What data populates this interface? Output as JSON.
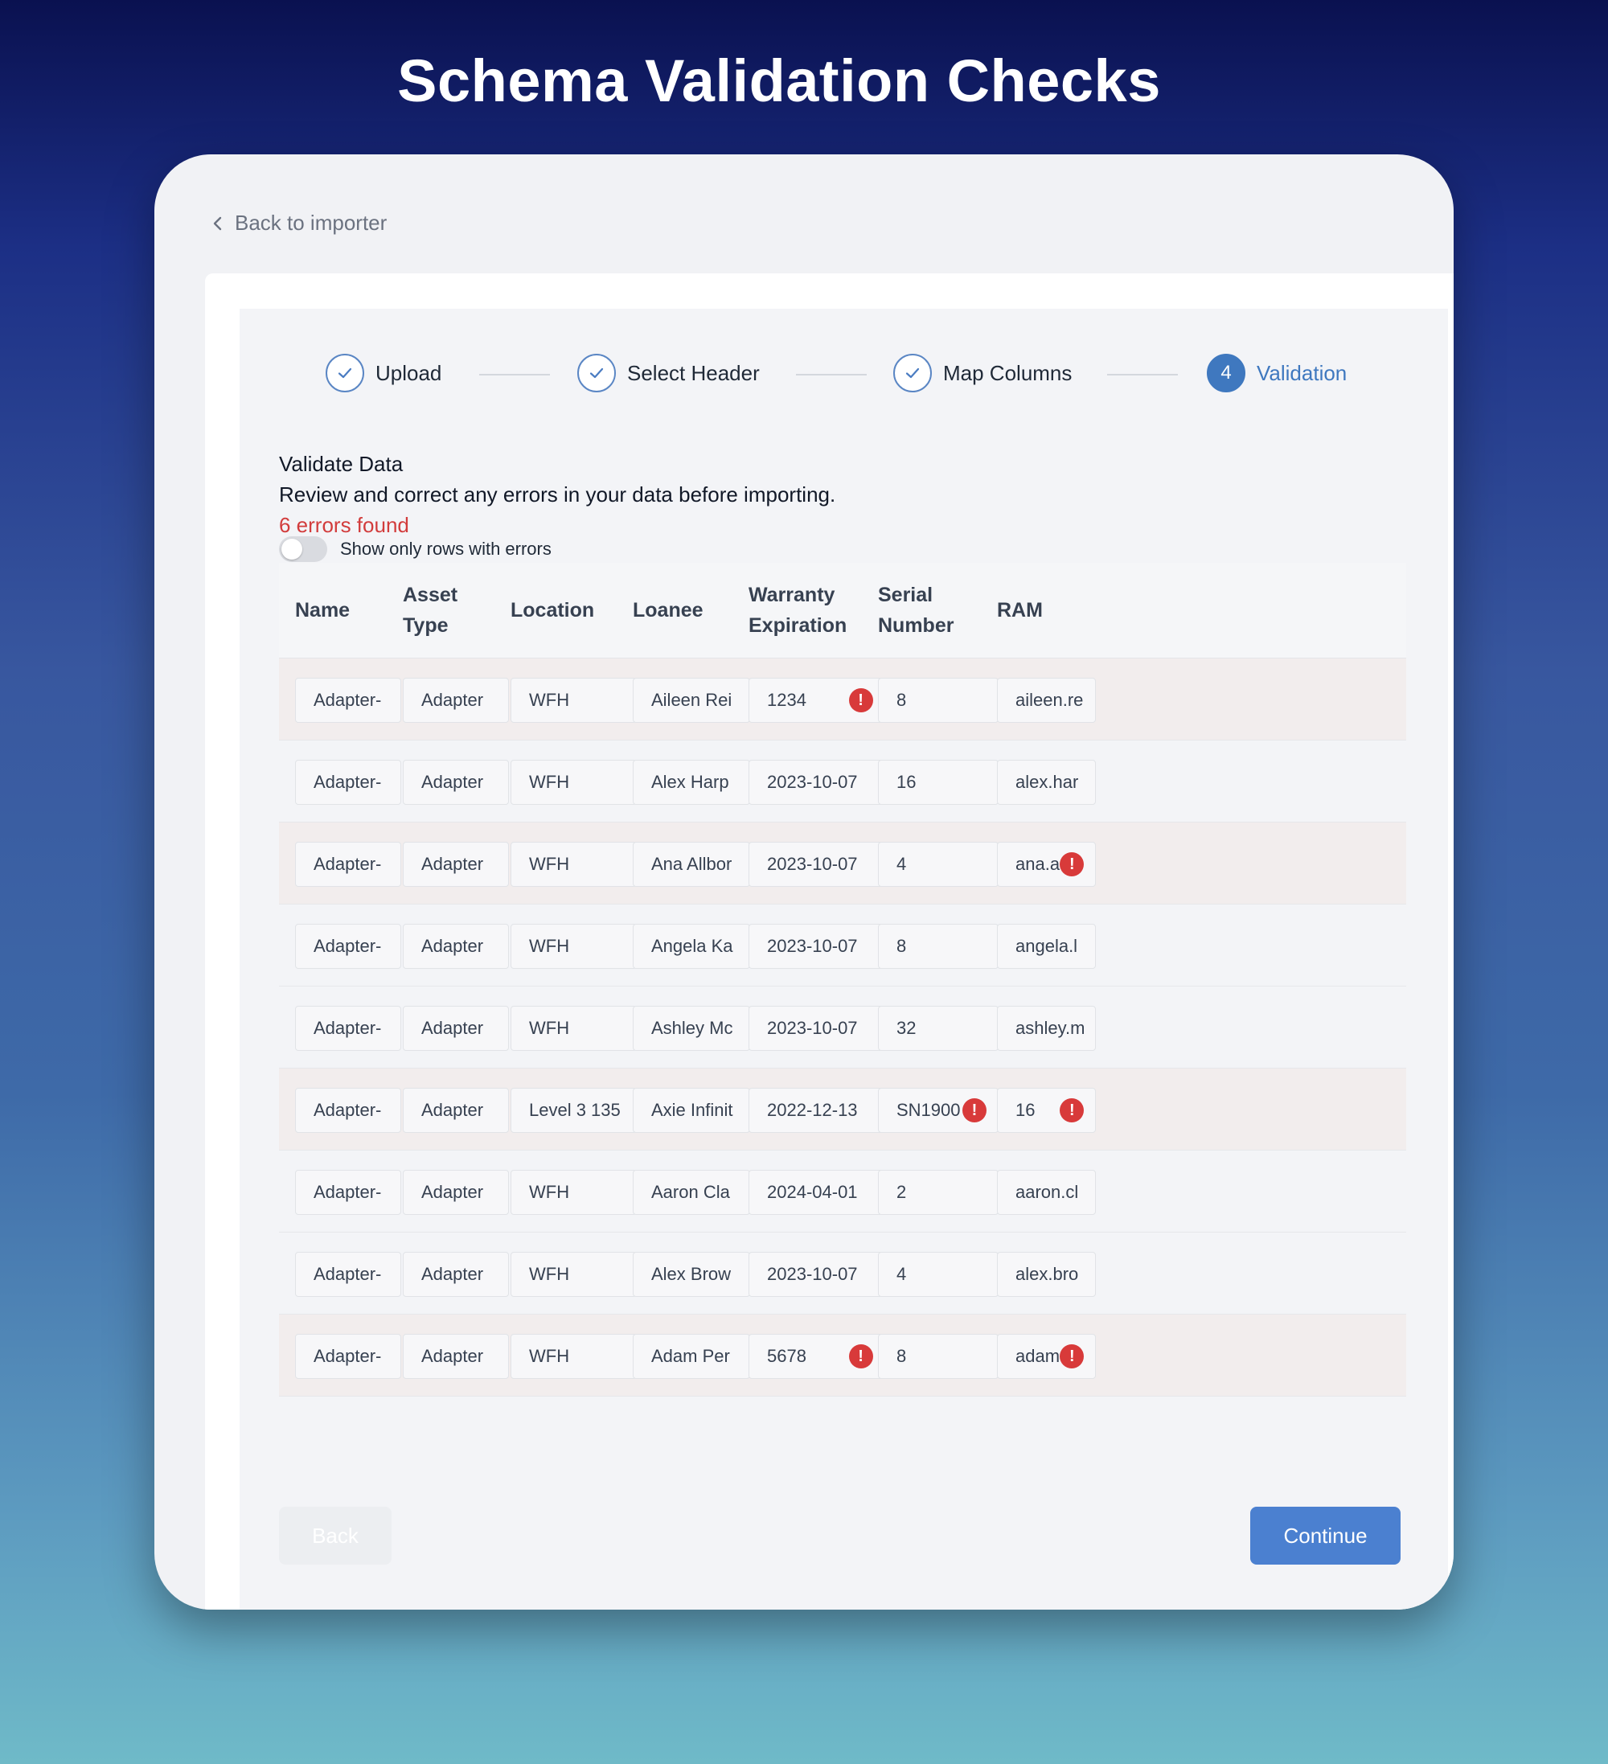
{
  "page_title": "Schema Validation Checks",
  "back_link": "Back to importer",
  "steps": [
    {
      "label": "Upload",
      "status": "done"
    },
    {
      "label": "Select Header",
      "status": "done"
    },
    {
      "label": "Map Columns",
      "status": "done"
    },
    {
      "label": "Validation",
      "number": "4",
      "status": "active"
    }
  ],
  "validate": {
    "title": "Validate Data",
    "description": "Review and correct any errors in your data before importing.",
    "error_count": "6 errors found",
    "toggle_label": "Show only rows with errors",
    "toggle_on": false
  },
  "table": {
    "columns": [
      "Name",
      "Asset Type",
      "Location",
      "Loanee",
      "Warranty Expiration",
      "Serial Number",
      "RAM"
    ],
    "rows": [
      {
        "has_error": true,
        "cells": [
          "Adapter-",
          "Adapter",
          "WFH",
          "Aileen Rei",
          "1234",
          "8",
          "aileen.re"
        ],
        "errors": [
          4
        ]
      },
      {
        "has_error": false,
        "cells": [
          "Adapter-",
          "Adapter",
          "WFH",
          "Alex Harp",
          "2023-10-07",
          "16",
          "alex.har"
        ],
        "errors": []
      },
      {
        "has_error": true,
        "cells": [
          "Adapter-",
          "Adapter",
          "WFH",
          "Ana Allbor",
          "2023-10-07",
          "4",
          "ana.a"
        ],
        "errors": [
          6
        ]
      },
      {
        "has_error": false,
        "cells": [
          "Adapter-",
          "Adapter",
          "WFH",
          "Angela Ka",
          "2023-10-07",
          "8",
          "angela.l"
        ],
        "errors": []
      },
      {
        "has_error": false,
        "cells": [
          "Adapter-",
          "Adapter",
          "WFH",
          "Ashley Mc",
          "2023-10-07",
          "32",
          "ashley.m"
        ],
        "errors": []
      },
      {
        "has_error": true,
        "cells": [
          "Adapter-",
          "Adapter",
          "Level 3 135",
          "Axie Infinit",
          "2022-12-13",
          "SN1900",
          "16"
        ],
        "errors": [
          5,
          6
        ]
      },
      {
        "has_error": false,
        "cells": [
          "Adapter-",
          "Adapter",
          "WFH",
          "Aaron Cla",
          "2024-04-01",
          "2",
          "aaron.cl"
        ],
        "errors": []
      },
      {
        "has_error": false,
        "cells": [
          "Adapter-",
          "Adapter",
          "WFH",
          "Alex Brow",
          "2023-10-07",
          "4",
          "alex.bro"
        ],
        "errors": []
      },
      {
        "has_error": true,
        "cells": [
          "Adapter-",
          "Adapter",
          "WFH",
          "Adam Per",
          "5678",
          "8",
          "adam"
        ],
        "errors": [
          4,
          6
        ]
      }
    ]
  },
  "buttons": {
    "back": "Back",
    "continue": "Continue"
  },
  "colors": {
    "accent": "#4b80d0",
    "error": "#d83a3a",
    "error_text": "#d23c3c"
  },
  "icons": {
    "back": "chevron-left-icon",
    "done_step": "check-icon",
    "cell_error": "exclamation-icon"
  }
}
